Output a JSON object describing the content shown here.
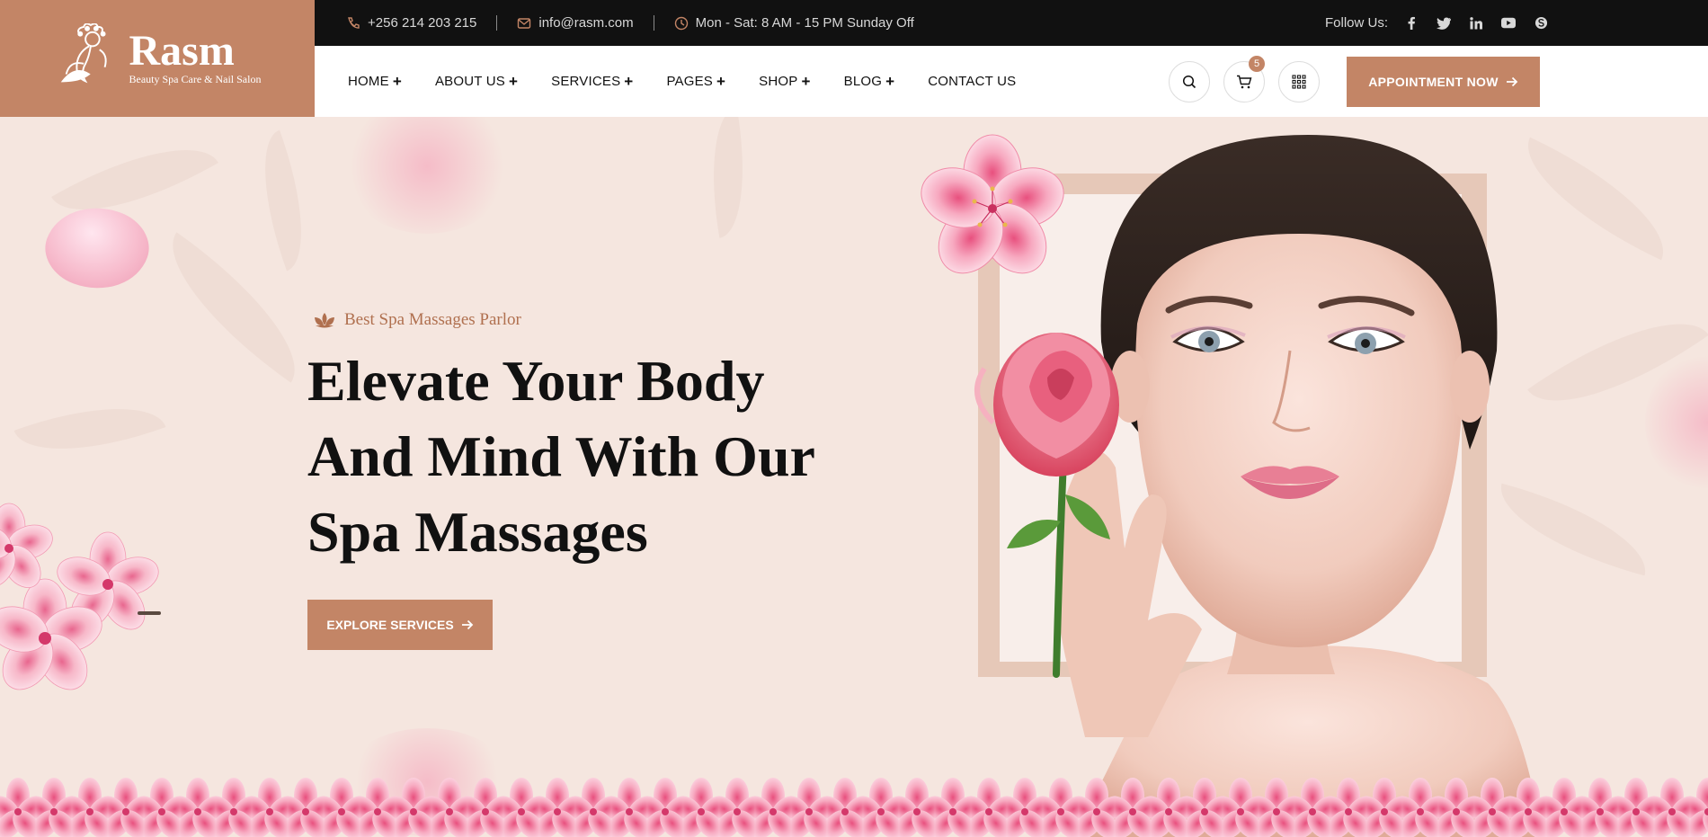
{
  "brand": {
    "name": "Rasm",
    "tagline": "Beauty Spa Care & Nail Salon"
  },
  "topbar": {
    "phone": "+256 214 203 215",
    "email": "info@rasm.com",
    "hours": "Mon - Sat: 8 AM - 15 PM Sunday Off",
    "follow_label": "Follow Us:",
    "socials": [
      "facebook-icon",
      "twitter-icon",
      "linkedin-icon",
      "youtube-icon",
      "skype-icon"
    ]
  },
  "nav": {
    "items": [
      {
        "label": "HOME",
        "has_submenu": true
      },
      {
        "label": "ABOUT US",
        "has_submenu": true
      },
      {
        "label": "SERVICES",
        "has_submenu": true
      },
      {
        "label": "PAGES",
        "has_submenu": true
      },
      {
        "label": "SHOP",
        "has_submenu": true
      },
      {
        "label": "BLOG",
        "has_submenu": true
      },
      {
        "label": "CONTACT US",
        "has_submenu": false
      }
    ],
    "cart_count": "5",
    "appointment_label": "APPOINTMENT NOW"
  },
  "hero": {
    "subtitle": "Best Spa Massages Parlor",
    "headline": [
      "Elevate Your Body",
      "And Mind With Our",
      "Spa Massages"
    ],
    "cta_label": "EXPLORE SERVICES"
  },
  "colors": {
    "accent": "#c38566",
    "topbar_bg": "#111111",
    "hero_bg": "#f5e6df",
    "frame": "#e6c8b8"
  }
}
